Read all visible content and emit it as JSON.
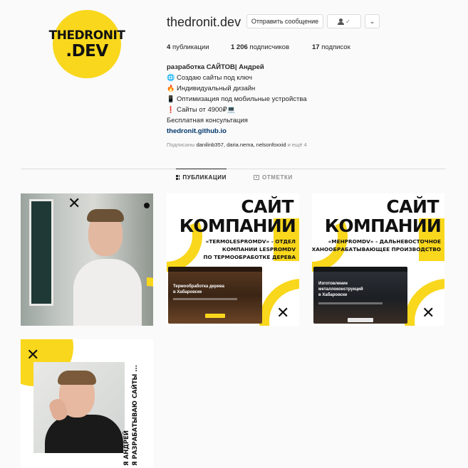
{
  "profile": {
    "avatar_line1": "THEDRONIT",
    "avatar_line2": ".DEV",
    "username": "thedronit.dev",
    "message_button": "Отправить сообщение",
    "check_glyph": "✓",
    "more_glyph": "⌄"
  },
  "stats": {
    "posts_count": "4",
    "posts_label": "публикации",
    "followers_count": "1 206",
    "followers_label": "подписчиков",
    "following_count": "17",
    "following_label": "подписок"
  },
  "bio": {
    "name": "разработка САЙТОВ| Андрей",
    "lines": [
      {
        "emoji": "🌐",
        "text": "Создаю сайты под ключ"
      },
      {
        "emoji": "🔥",
        "text": "Индивидуальный дизайн"
      },
      {
        "emoji": "📱",
        "text": "Оптимизация под мобильные устройства"
      },
      {
        "emoji": "❗",
        "text": "Сайты от 4900₽💻"
      }
    ],
    "consult": "Бесплатная консультация",
    "link": "thedronit.github.io"
  },
  "followed_by": {
    "prefix": "Подписаны",
    "names": "danilinb357, daria.nema, nelsonfoxxid",
    "suffix": "и ещё 4"
  },
  "tabs": {
    "posts": "ПУБЛИКАЦИИ",
    "tagged": "ОТМЕТКИ"
  },
  "posts": {
    "x_glyph": "✕",
    "post2": {
      "title1": "САЙТ",
      "title2": "КОМПАНИИ",
      "sub1": "«TERMOLESPROMDV» - ОТДЕЛ",
      "sub2": "КОМПАНИИ LESPROMDV",
      "sub3": "ПО ТЕРМООБРАБОТКЕ ДЕРЕВА",
      "screen1": "Термообработка дерева",
      "screen2": "в Хабаровске"
    },
    "post3": {
      "title1": "САЙТ",
      "title2": "КОМПАНИИ",
      "sub1": "«MEHPROMDV» - ДАЛЬНЕВОСТОЧНОЕ",
      "sub2": "МЕХАНООБРАБАТЫВАЮЩЕЕ ПРОИЗВОДСТВО",
      "screen1": "Изготовление",
      "screen2": "металлоконструкций",
      "screen3": "в Хабаровске"
    },
    "post4": {
      "vline1": "Я АНДРЕЙ",
      "vline2": "Я РАЗРАБАТЫВАЮ САЙТЫ ..."
    }
  }
}
